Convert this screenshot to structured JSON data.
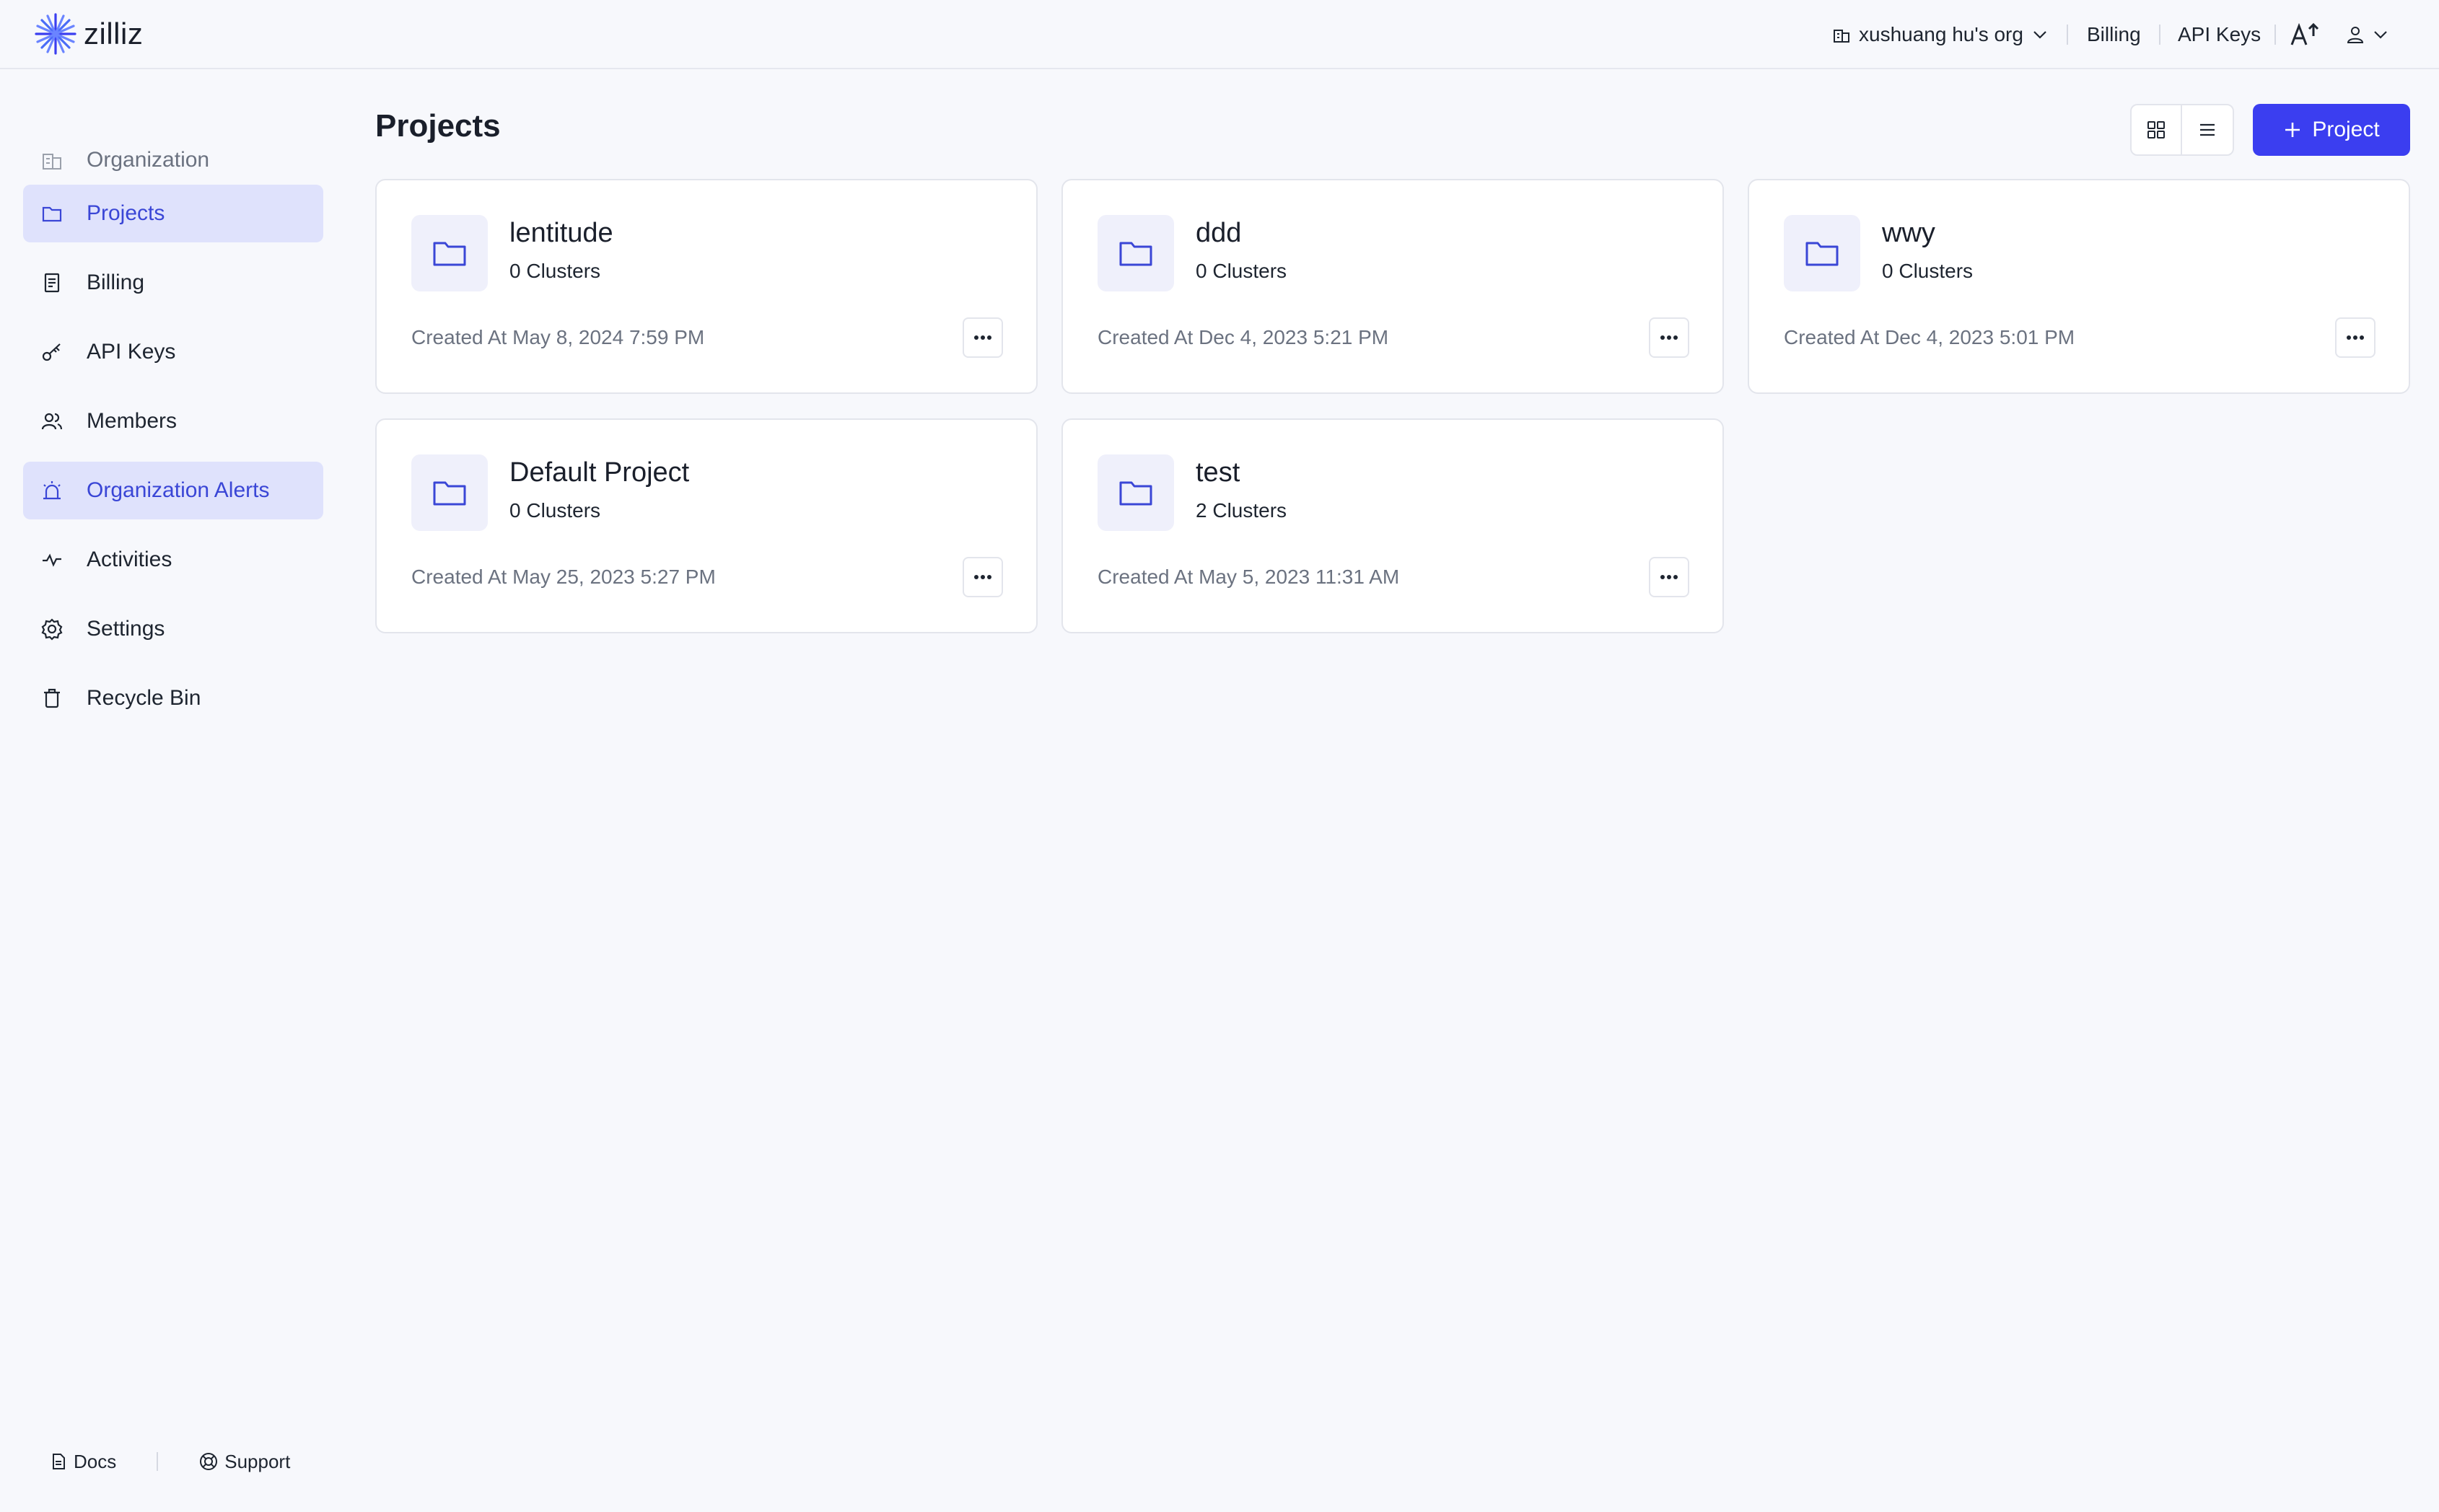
{
  "header": {
    "logo_text": "zilliz",
    "org_name": "xushuang hu's org",
    "billing_label": "Billing",
    "api_keys_label": "API Keys"
  },
  "sidebar": {
    "items": [
      {
        "label": "Organization",
        "icon": "building-icon"
      },
      {
        "label": "Projects",
        "icon": "folder-icon",
        "active": true
      },
      {
        "label": "Billing",
        "icon": "receipt-icon"
      },
      {
        "label": "API Keys",
        "icon": "key-icon"
      },
      {
        "label": "Members",
        "icon": "users-icon"
      },
      {
        "label": "Organization Alerts",
        "icon": "alarm-icon",
        "highlighted": true
      },
      {
        "label": "Activities",
        "icon": "activity-icon"
      },
      {
        "label": "Settings",
        "icon": "gear-icon"
      },
      {
        "label": "Recycle Bin",
        "icon": "trash-icon"
      }
    ],
    "footer": {
      "docs_label": "Docs",
      "support_label": "Support"
    }
  },
  "main": {
    "title": "Projects",
    "add_button_label": "Project",
    "projects": [
      {
        "name": "lentitude",
        "clusters": "0 Clusters",
        "created": "Created At May 8, 2024 7:59 PM"
      },
      {
        "name": "ddd",
        "clusters": "0 Clusters",
        "created": "Created At Dec 4, 2023 5:21 PM"
      },
      {
        "name": "wwy",
        "clusters": "0 Clusters",
        "created": "Created At Dec 4, 2023 5:01 PM"
      },
      {
        "name": "Default Project",
        "clusters": "0 Clusters",
        "created": "Created At May 25, 2023 5:27 PM"
      },
      {
        "name": "test",
        "clusters": "2 Clusters",
        "created": "Created At May 5, 2023 11:31 AM"
      }
    ]
  },
  "colors": {
    "accent": "#3b3ef0",
    "active_nav_bg": "#dfe2fc",
    "active_nav_text": "#3a46d6",
    "page_bg": "#f7f8fc"
  }
}
